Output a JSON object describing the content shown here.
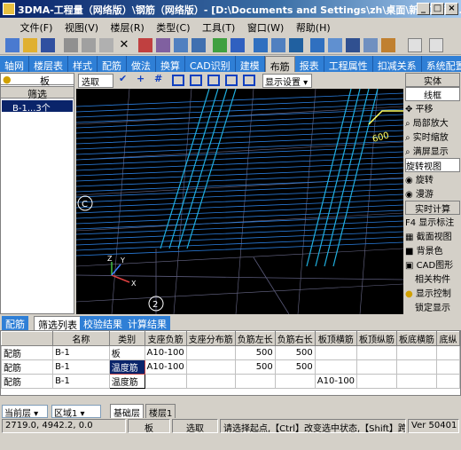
{
  "window": {
    "title": "3DMA-工程量（网络版）\\钢筋（网络版）- [D:\\Documents and Settings\\zh\\桌面\\新建工程.b..."
  },
  "menu": [
    "文件(F)",
    "视图(V)",
    "楼层(R)",
    "类型(C)",
    "工具(T)",
    "窗口(W)",
    "帮助(H)"
  ],
  "modules": [
    "轴网",
    "楼层表",
    "样式",
    "配筋",
    "做法",
    "换算",
    "CAD识别",
    "建模",
    "布筋",
    "报表",
    "工程属性",
    "扣减关系",
    "系统配置"
  ],
  "active_module": "布筋",
  "left": {
    "selector": "板",
    "filter": "筛选",
    "item": "B-1...3个"
  },
  "toolbar2": {
    "select": "选取",
    "display": "显示设置"
  },
  "right_panel": [
    "实体",
    "线框",
    "平移",
    "局部放大",
    "实时缩放",
    "满屏显示",
    "旋转视图",
    "旋转",
    "漫游",
    "实时计算",
    "F4 显示标注",
    "截面视图",
    "背景色",
    "CAD图形",
    "相关构件",
    "显示控制",
    "锁定显示"
  ],
  "canvas_labels": {
    "c": "C",
    "two": "2",
    "dim": "600"
  },
  "bottom_tabs": [
    "配筋",
    "筛选列表",
    "校验结果",
    "计算结果"
  ],
  "active_bottom_tab": "筛选列表",
  "grid": {
    "headers": [
      "",
      "名称",
      "类别",
      "支座负筋",
      "支座分布筋",
      "负筋左长",
      "负筋右长",
      "板顶横筋",
      "板顶纵筋",
      "板底横筋",
      "底纵"
    ],
    "rows": [
      [
        "配筋",
        "B-1",
        "板",
        "A10-100",
        "",
        "500",
        "500",
        "",
        "",
        "",
        ""
      ],
      [
        "配筋",
        "B-1",
        "温度筋",
        "A10-100",
        "",
        "500",
        "500",
        "",
        "",
        "",
        ""
      ],
      [
        "配筋",
        "B-1",
        "温度筋",
        "",
        "",
        "",
        "",
        "A10-100",
        "",
        "",
        ""
      ]
    ]
  },
  "layer": {
    "label": "当前层",
    "region": "区域1",
    "tabs": [
      "基础层",
      "楼层1"
    ]
  },
  "status": {
    "coords": "2719.0, 4942.2, 0.0",
    "type": "板",
    "mode": "选取",
    "hint": "请选择起点,【Ctrl】改变选中状态,【Shift】跨类",
    "version": "Ver 50401"
  }
}
